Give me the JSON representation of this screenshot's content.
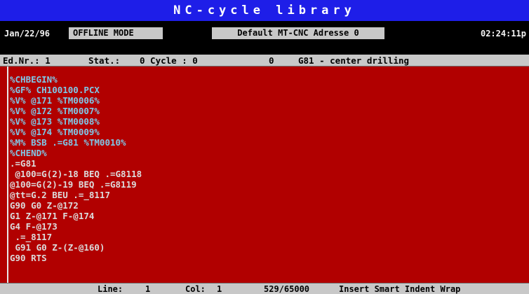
{
  "app": {
    "title": "NC-cycle library"
  },
  "status": {
    "date": "Jan/22/96",
    "mode": "OFFLINE MODE",
    "address": "Default MT-CNC Adresse 0",
    "time": "02:24:11p"
  },
  "info": {
    "nr": "Ed.Nr.: 1",
    "stat": "Stat.:",
    "cycle": "0 Cycle : 0",
    "num": "0",
    "desc": "G81 - center drilling"
  },
  "editor": {
    "lines": [
      {
        "text": "%CHBEGIN%",
        "tag": true
      },
      {
        "text": "%GF% CH100100.PCX",
        "tag": true
      },
      {
        "text": "%V% @171 %TM0006%",
        "tag": true
      },
      {
        "text": "%V% @172 %TM0007%",
        "tag": true
      },
      {
        "text": "%V% @173 %TM0008%",
        "tag": true
      },
      {
        "text": "%V% @174 %TM0009%",
        "tag": true
      },
      {
        "text": "%M% BSB .=G81 %TM0010%",
        "tag": true
      },
      {
        "text": "%CHEND%",
        "tag": true
      },
      {
        "text": ".=G81",
        "tag": false
      },
      {
        "text": " @100=G(2)-18 BEQ .=G8118",
        "tag": false
      },
      {
        "text": "@100=G(2)-19 BEQ .=G8119",
        "tag": false
      },
      {
        "text": "@tt=G.2 BEU .=_8117",
        "tag": false
      },
      {
        "text": "G90 G0 Z-@172",
        "tag": false
      },
      {
        "text": "G1 Z-@171 F-@174",
        "tag": false
      },
      {
        "text": "G4 F-@173",
        "tag": false
      },
      {
        "text": " .=_8117",
        "tag": false
      },
      {
        "text": " G91 G0 Z-(Z-@160)",
        "tag": false
      },
      {
        "text": "G90 RTS",
        "tag": false
      }
    ]
  },
  "bottom": {
    "line_label": "Line:",
    "line_value": "1",
    "col_label": "Col:",
    "col_value": "1",
    "memory": "529/65000",
    "modes": "Insert Smart Indent Wrap"
  }
}
